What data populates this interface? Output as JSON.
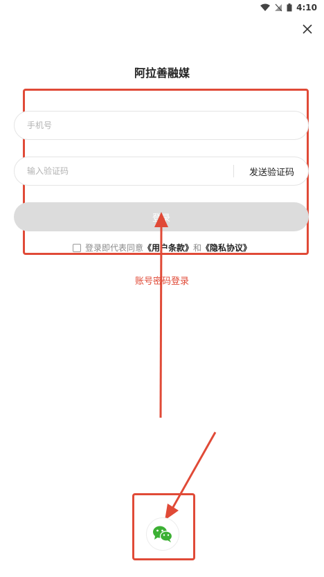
{
  "status_bar": {
    "time": "4:10"
  },
  "app": {
    "title": "阿拉善融媒"
  },
  "form": {
    "phone_placeholder": "手机号",
    "code_placeholder": "输入验证码",
    "send_code_label": "发送验证码",
    "login_label": "登录",
    "agreement": {
      "prefix": "登录即代表同意",
      "terms": "《用户条款》",
      "conjunction": "和",
      "privacy": "《隐私协议》"
    }
  },
  "account_login_label": "账号密码登录",
  "colors": {
    "annotation_red": "#e04a37",
    "wechat_green": "#3cb034",
    "login_button_disabled": "#dcdcdc"
  },
  "icons": {
    "close": "close-icon",
    "wechat": "wechat-icon"
  }
}
